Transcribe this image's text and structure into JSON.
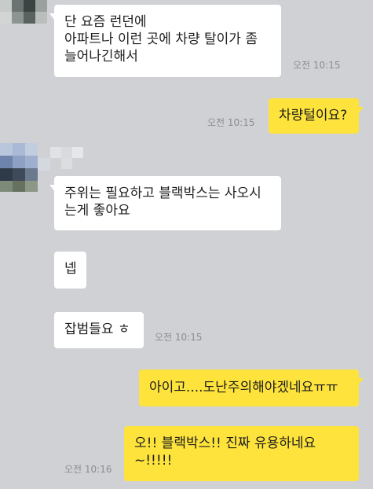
{
  "messages": [
    {
      "text": "단 요즘 런던에\n아파트나 이런 곳에 차량 탈이가 좀\n늘어나긴해서",
      "time": "오전 10:15"
    },
    {
      "text": "차량털이요?",
      "time": "오전 10:15"
    },
    {
      "text": "주위는 필요하고 블랙박스는 사오시\n는게 좋아요"
    },
    {
      "text": "넵"
    },
    {
      "text": "잡범들요 ㅎ",
      "time": "오전 10:15"
    },
    {
      "text": "아이고....도난주의해야겠네요ㅠㅠ"
    },
    {
      "text": "오!! 블랙박스!! 진짜 유용하네요\n~!!!!!",
      "time": "오전 10:16"
    }
  ],
  "colors": {
    "background": "#cfd1d4",
    "incoming_bubble": "#ffffff",
    "outgoing_bubble": "#fde33b",
    "timestamp": "#8a8d91"
  },
  "icons": {
    "avatar": "blurred-profile-avatar-icon"
  }
}
